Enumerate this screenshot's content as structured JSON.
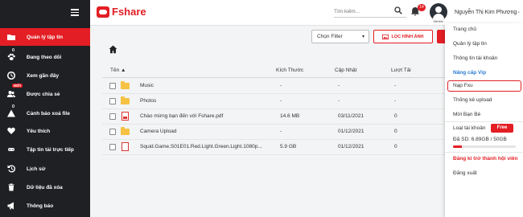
{
  "app": {
    "logo_text": "Fshare",
    "brand_color": "#e31e24"
  },
  "sidebar": {
    "items": [
      {
        "label": "Quản lý tập tin",
        "icon": "folder-icon",
        "active": true
      },
      {
        "label": "Đang theo dõi",
        "icon": "paw-icon",
        "badge": "0"
      },
      {
        "label": "Xem gần đây",
        "icon": "clock-icon"
      },
      {
        "label": "Được chia sẻ",
        "icon": "users-icon",
        "tag": "MỚI"
      },
      {
        "label": "Cảnh báo xoá file",
        "icon": "warning-icon",
        "badge": "0"
      },
      {
        "label": "Yêu thích",
        "icon": "heart-icon"
      },
      {
        "label": "Tập tin tải trực tiếp",
        "icon": "link-icon"
      },
      {
        "label": "Lịch sử",
        "icon": "history-icon"
      },
      {
        "label": "Dữ liệu đã xóa",
        "icon": "trash-icon"
      },
      {
        "label": "Thông báo",
        "icon": "megaphone-icon"
      }
    ]
  },
  "header": {
    "search_placeholder": "Tìm kiếm...",
    "notification_count": "14",
    "avatar_label": "Member",
    "user_name": "Nguyễn Thị Kim Phượng"
  },
  "toolbar": {
    "filter_value": "Chọn Filter",
    "filter_button_label": "LỌC HÌNH ẢNH"
  },
  "table": {
    "headers": {
      "name": "Tên ▲",
      "size": "Kích Thước",
      "updated": "Cập Nhật",
      "downloads": "Lượt Tải"
    },
    "rows": [
      {
        "type": "folder",
        "name": "Music",
        "size": "-",
        "updated": "-",
        "downloads": "-"
      },
      {
        "type": "folder",
        "name": "Photos",
        "size": "-",
        "updated": "-",
        "downloads": "-"
      },
      {
        "type": "pdf",
        "name": "Chào mừng bạn đến với Fshare.pdf",
        "size": "14.6 MB",
        "updated": "03/11/2021",
        "downloads": "0"
      },
      {
        "type": "folder",
        "name": "Camera Upload",
        "size": "-",
        "updated": "01/12/2021",
        "downloads": "0"
      },
      {
        "type": "file",
        "name": "Squid.Game.S01E01.Red.Light.Green.Light.1080p...",
        "size": "5.9 GB",
        "updated": "01/12/2021",
        "downloads": "0"
      }
    ]
  },
  "menu": {
    "items": [
      "Trang chủ",
      "Quản lý tập tin",
      "Thông tin tài khoản",
      "Nâng cấp Vip",
      "Nạp Fxu",
      "Thống kê upload",
      "Mời Bạn Bè"
    ],
    "account_type_label": "Loại tài khoản",
    "account_type_value": "Free",
    "usage_text": "Đã SD: 6.89GB / 50GB",
    "usage_fraction": 0.14,
    "register_label": "Đăng kí trở thành hội viên",
    "logout_label": "Đăng xuất"
  }
}
